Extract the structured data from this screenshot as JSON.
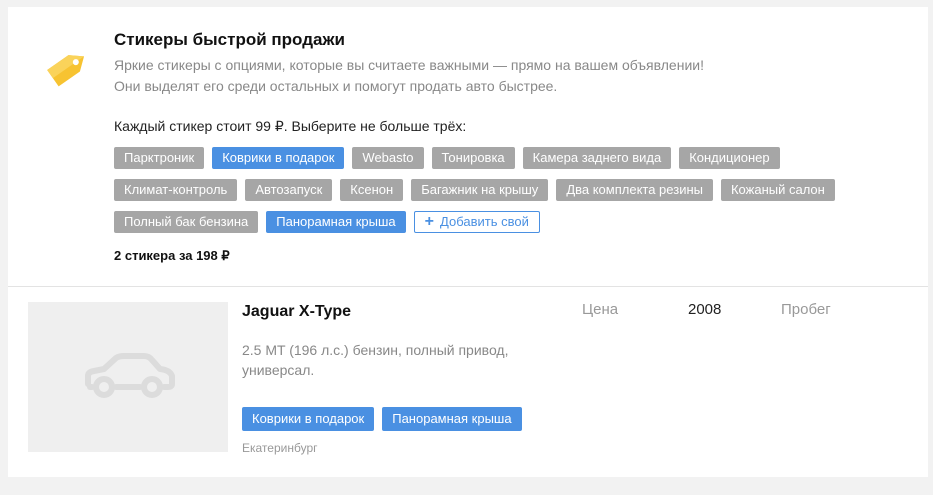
{
  "promo": {
    "title": "Стикеры быстрой продажи",
    "description_line1": "Яркие стикеры с опциями, которые вы считаете важными — прямо на вашем объявлении!",
    "description_line2": "Они выделят его среди остальных и помогут продать авто быстрее.",
    "price_note": "Каждый стикер стоит 99 ₽. Выберите не больше трёх:",
    "stickers": [
      {
        "label": "Парктроник",
        "selected": false
      },
      {
        "label": "Коврики в подарок",
        "selected": true
      },
      {
        "label": "Webasto",
        "selected": false
      },
      {
        "label": "Тонировка",
        "selected": false
      },
      {
        "label": "Камера заднего вида",
        "selected": false
      },
      {
        "label": "Кондиционер",
        "selected": false
      },
      {
        "label": "Климат-контроль",
        "selected": false
      },
      {
        "label": "Автозапуск",
        "selected": false
      },
      {
        "label": "Ксенон",
        "selected": false
      },
      {
        "label": "Багажник на крышу",
        "selected": false
      },
      {
        "label": "Два комплекта резины",
        "selected": false
      },
      {
        "label": "Кожаный салон",
        "selected": false
      },
      {
        "label": "Полный бак бензина",
        "selected": false
      },
      {
        "label": "Панорамная крыша",
        "selected": true
      }
    ],
    "add_own_label": "Добавить свой",
    "total": "2 стикера за 198 ₽",
    "icon_color": "#f7c331"
  },
  "listing": {
    "title": "Jaguar X-Type",
    "description": "2.5 MT (196 л.с.) бензин, полный привод, универсал.",
    "price_label": "Цена",
    "year": "2008",
    "mileage_label": "Пробег",
    "stickers": [
      "Коврики в подарок",
      "Панорамная крыша"
    ],
    "city": "Екатеринбург"
  },
  "colors": {
    "accent": "#4a90e2",
    "chip_inactive": "#a6a6a6"
  }
}
